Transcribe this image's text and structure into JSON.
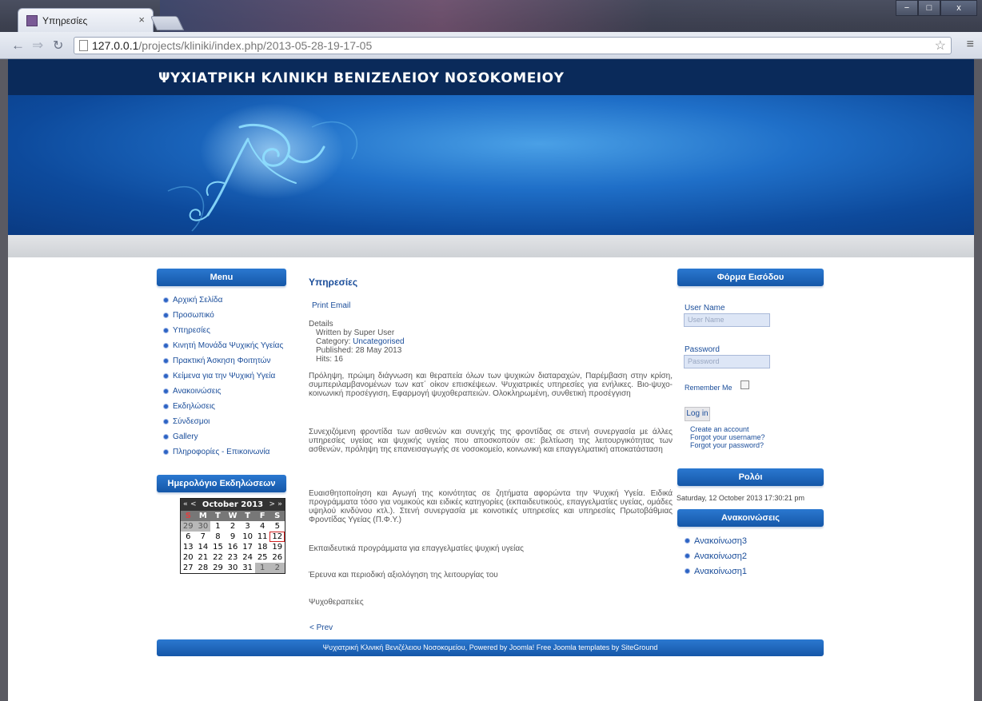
{
  "browser": {
    "tab_title": "Υπηρεσίες",
    "tab_close": "×",
    "url_host": "127.0.0.1",
    "url_path": "/projects/kliniki/index.php/2013-05-28-19-17-05",
    "window_minimize": "−",
    "window_maximize": "□",
    "window_close": "x"
  },
  "site": {
    "title": "ΨΥΧΙΑΤΡΙΚΗ ΚΛΙΝΙΚΗ ΒΕΝΙΖΕΛΕΙΟΥ ΝΟΣΟΚΟΜΕΙΟΥ"
  },
  "menu": {
    "title": "Menu",
    "items": [
      "Αρχική Σελίδα",
      "Προσωπικό",
      "Υπηρεσίες",
      "Κινητή Μονάδα Ψυχικής Υγείας",
      "Πρακτική Άσκηση Φοιτητών",
      "Κείμενα για την Ψυχική Υγεία",
      "Ανακοινώσεις",
      "Εκδηλώσεις",
      "Σύνδεσμοι",
      "Gallery",
      "Πληροφορίες - Επικοινωνία"
    ]
  },
  "calendar": {
    "title": "Ημερολόγιο Εκδηλώσεων",
    "prev": "« <",
    "month": "October 2013",
    "next": "> »",
    "weekdays": [
      "S",
      "M",
      "T",
      "W",
      "T",
      "F",
      "S"
    ],
    "weeks": [
      [
        "29",
        "30",
        "1",
        "2",
        "3",
        "4",
        "5"
      ],
      [
        "6",
        "7",
        "8",
        "9",
        "10",
        "11",
        "12"
      ],
      [
        "13",
        "14",
        "15",
        "16",
        "17",
        "18",
        "19"
      ],
      [
        "20",
        "21",
        "22",
        "23",
        "24",
        "25",
        "26"
      ],
      [
        "27",
        "28",
        "29",
        "30",
        "31",
        "1",
        "2"
      ]
    ]
  },
  "article": {
    "title": "Υπηρεσίες",
    "print": "Print",
    "email": "Email",
    "details_label": "Details",
    "written_by": "Written by Super User",
    "category_label": "Category:",
    "category_value": "Uncategorised",
    "published": "Published: 28 May 2013",
    "hits": "Hits: 16",
    "paragraphs": [
      "Πρόληψη, πρώιμη διάγνωση και θεραπεία όλων των ψυχικών διαταραχών, Παρέμβαση στην κρίση, συμπεριλαμβανομένων των κατ΄ οίκον επισκέψεων. Ψυχιατρικές υπηρεσίες για ενήλικες. Βιο-ψυχο-κοινωνική προσέγγιση, Εφαρμογή ψυχοθεραπειών. Ολοκληρωμένη, συνθετική προσέγγιση",
      "Συνεχιζόμενη φροντίδα των ασθενών και συνεχής της φροντίδας σε στενή συνεργασία με άλλες υπηρεσίες υγείας και ψυχικής υγείας που αποσκοπούν σε: βελτίωση της λειτουργικότητας των ασθενών, πρόληψη της επανεισαγωγής σε νοσοκομείο, κοινωνική και επαγγελματική αποκατάσταση",
      "Ευαισθητοποίηση και Αγωγή της κοινότητας σε ζητήματα αφορώντα την Ψυχική Υγεία. Ειδικά προγράμματα τόσο για νομικούς και ειδικές κατηγορίες (εκπαιδευτικούς, επαγγελματίες υγείας, ομάδες υψηλού κινδύνου κτλ.). Στενή συνεργασία με κοινοτικές υπηρεσίες και υπηρεσίες Πρωτοβάθμιας Φροντίδας Υγείας (Π.Φ.Υ.)",
      "Εκπαιδευτικά προγράμματα για επαγγελματίες ψυχική υγείας",
      "Έρευνα και περιοδική αξιολόγηση της λειτουργίας του",
      "Ψυχοθεραπείες"
    ],
    "prev_link": "< Prev"
  },
  "login": {
    "title": "Φόρμα Εισόδου",
    "username_label": "User Name",
    "username_placeholder": "User Name",
    "password_label": "Password",
    "password_placeholder": "Password",
    "remember_label": "Remember Me",
    "login_button": "Log in",
    "create_account": "Create an account",
    "forgot_username": "Forgot your username?",
    "forgot_password": "Forgot your password?"
  },
  "clock": {
    "title": "Ρολόι",
    "datetime": "Saturday, 12 October 2013 17:30:21 pm"
  },
  "announcements": {
    "title": "Ανακοινώσεις",
    "items": [
      "Ανακοίνωση3",
      "Ανακοίνωση2",
      "Ανακοίνωση1"
    ]
  },
  "footer": {
    "text": "Ψυχιατρική Κλινική Βενιζέλειου Νοσοκομείου, Powered by Joomla! Free Joomla templates by SiteGround"
  },
  "colors": {
    "header_bg": "#0a2a5a",
    "accent_blue": "#1557a8",
    "link_blue": "#1a4d9a"
  }
}
